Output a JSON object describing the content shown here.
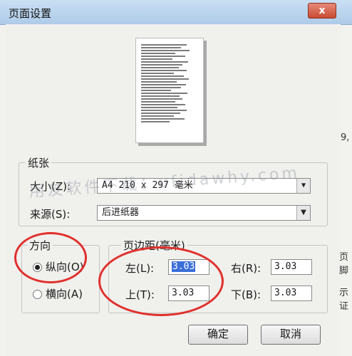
{
  "window": {
    "title": "页面设置",
    "close_glyph": "x"
  },
  "paper": {
    "group_label": "纸张",
    "size_label": "大小(Z):",
    "size_value": "A4 210 x 297 毫米",
    "source_label": "来源(S):",
    "source_value": "后进纸器"
  },
  "orientation": {
    "group_label": "方向",
    "portrait_label": "纵向(O)",
    "landscape_label": "横向(A)",
    "selected": "portrait"
  },
  "margins": {
    "group_label": "页边距(毫米)",
    "left_label": "左(L):",
    "left_value": "3.03",
    "right_label": "右(R):",
    "right_value": "3.03",
    "top_label": "上(T):",
    "top_value": "3.03",
    "bottom_label": "下(B):",
    "bottom_value": "3.03"
  },
  "buttons": {
    "ok": "确定",
    "cancel": "取消"
  },
  "watermark": "用友软件下载：ufidawhy.com",
  "background_fragments": {
    "a": "9,",
    "b": "页脚",
    "c": "示证"
  },
  "annotation_color": "#e0302c"
}
